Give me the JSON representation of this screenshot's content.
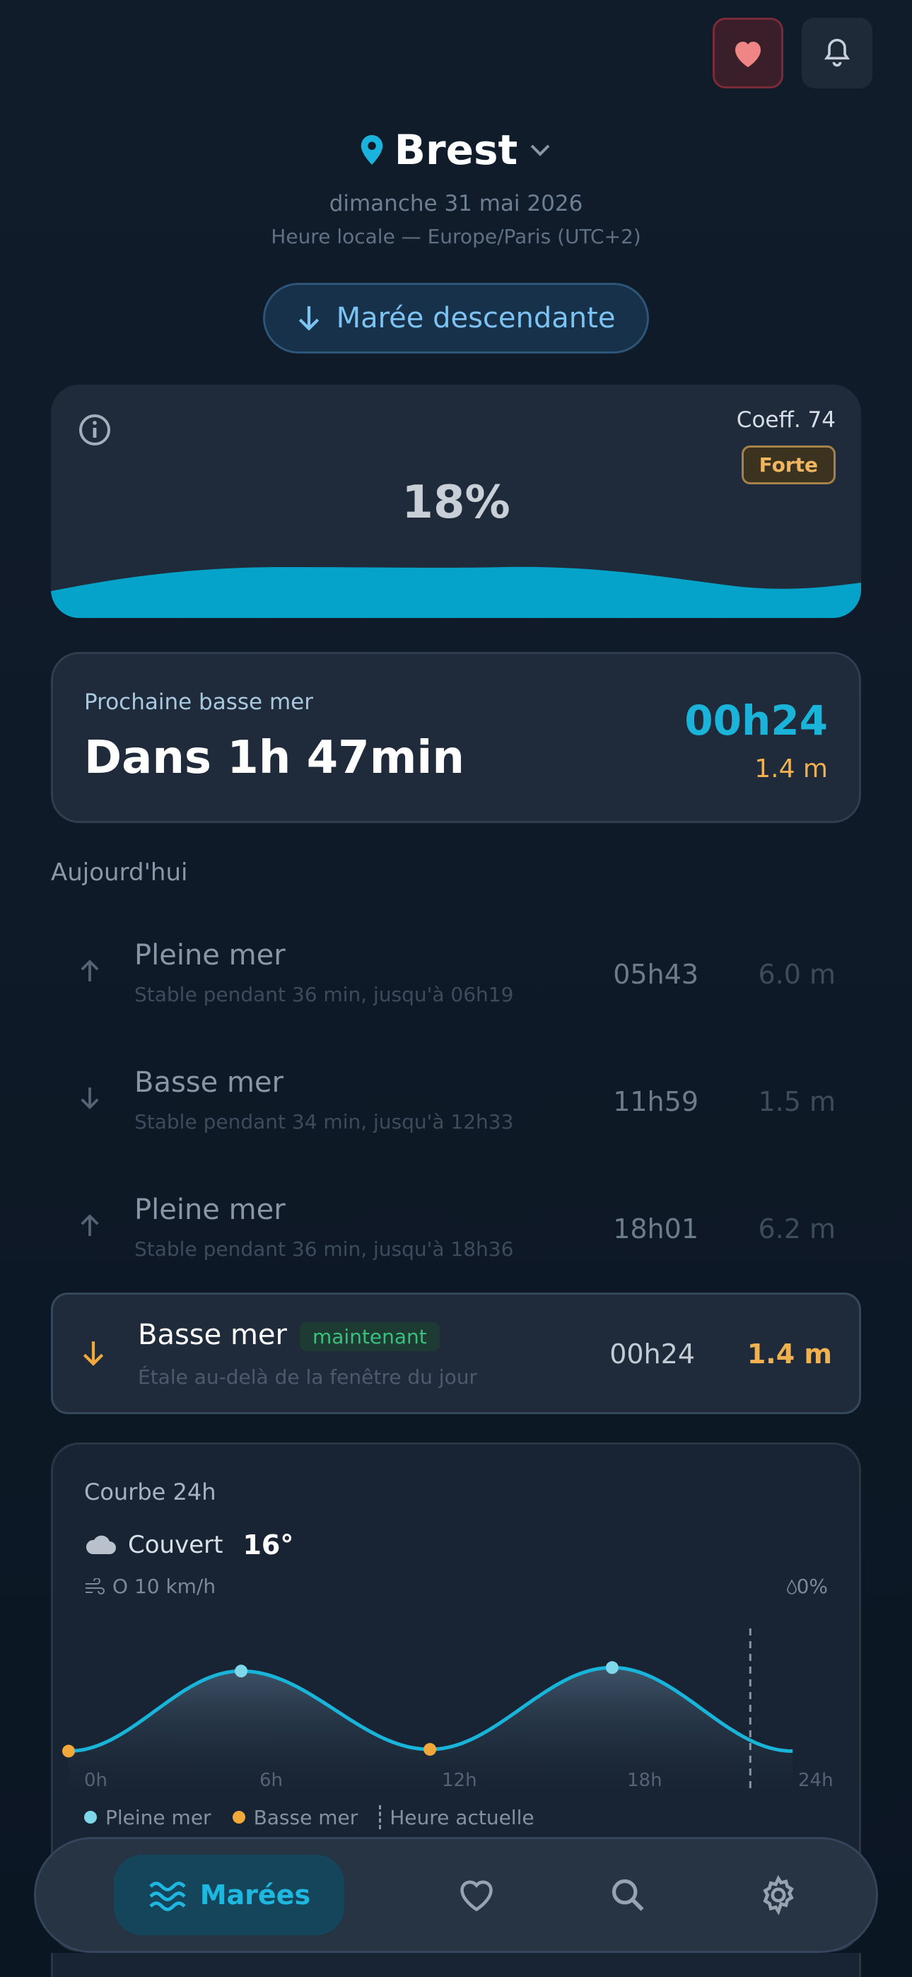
{
  "header": {
    "city": "Brest",
    "date": "dimanche 31 mai 2026",
    "timezone": "Heure locale — Europe/Paris (UTC+2)",
    "tide_state": "Marée descendante"
  },
  "gauge": {
    "coefficient": "Coeff. 74",
    "strength": "Forte",
    "percent": "18%",
    "level_fraction": 0.18
  },
  "next_tide": {
    "label": "Prochaine basse mer",
    "countdown": "Dans 1h 47min",
    "time": "00h24",
    "height": "1.4 m"
  },
  "today": {
    "title": "Aujourd'hui",
    "tides": [
      {
        "name": "Pleine mer",
        "detail": "Stable pendant 36 min, jusqu'à 06h19",
        "time": "05h43",
        "height": "6.0 m",
        "direction": "up"
      },
      {
        "name": "Basse mer",
        "detail": "Stable pendant 34 min, jusqu'à 12h33",
        "time": "11h59",
        "height": "1.5 m",
        "direction": "down"
      },
      {
        "name": "Pleine mer",
        "detail": "Stable pendant 36 min, jusqu'à 18h36",
        "time": "18h01",
        "height": "6.2 m",
        "direction": "up"
      }
    ],
    "current": {
      "name": "Basse mer",
      "badge": "maintenant",
      "detail": "Étale au-delà de la fenêtre du jour",
      "time": "00h24",
      "height": "1.4 m",
      "direction": "down"
    }
  },
  "curve": {
    "title": "Courbe 24h",
    "weather": {
      "condition": "Couvert",
      "temperature": "16°",
      "wind": "O 10 km/h",
      "rain": "0%"
    },
    "x_ticks": [
      "0h",
      "6h",
      "12h",
      "18h",
      "24h"
    ],
    "legend": {
      "high": "Pleine mer",
      "low": "Basse mer",
      "now": "Heure actuelle"
    },
    "colors": {
      "curve": "#18b4d9",
      "high": "#7fd8ea",
      "low": "#f2a93b"
    }
  },
  "chart_data": {
    "type": "line",
    "x": [
      0,
      5.72,
      11.98,
      18.02,
      24
    ],
    "y": [
      1.4,
      6.0,
      1.5,
      6.2,
      1.4
    ],
    "xlim": [
      0,
      24
    ],
    "current_hour": 22.6,
    "series": [
      {
        "name": "",
        "values": [
          1.4,
          6.0,
          1.5,
          6.2,
          1.4
        ]
      }
    ]
  },
  "nav": {
    "items": [
      {
        "label": "Marées",
        "icon": "waves-icon",
        "active": true
      },
      {
        "label": "",
        "icon": "heart-icon"
      },
      {
        "label": "",
        "icon": "search-icon"
      },
      {
        "label": "",
        "icon": "gear-icon"
      }
    ]
  }
}
